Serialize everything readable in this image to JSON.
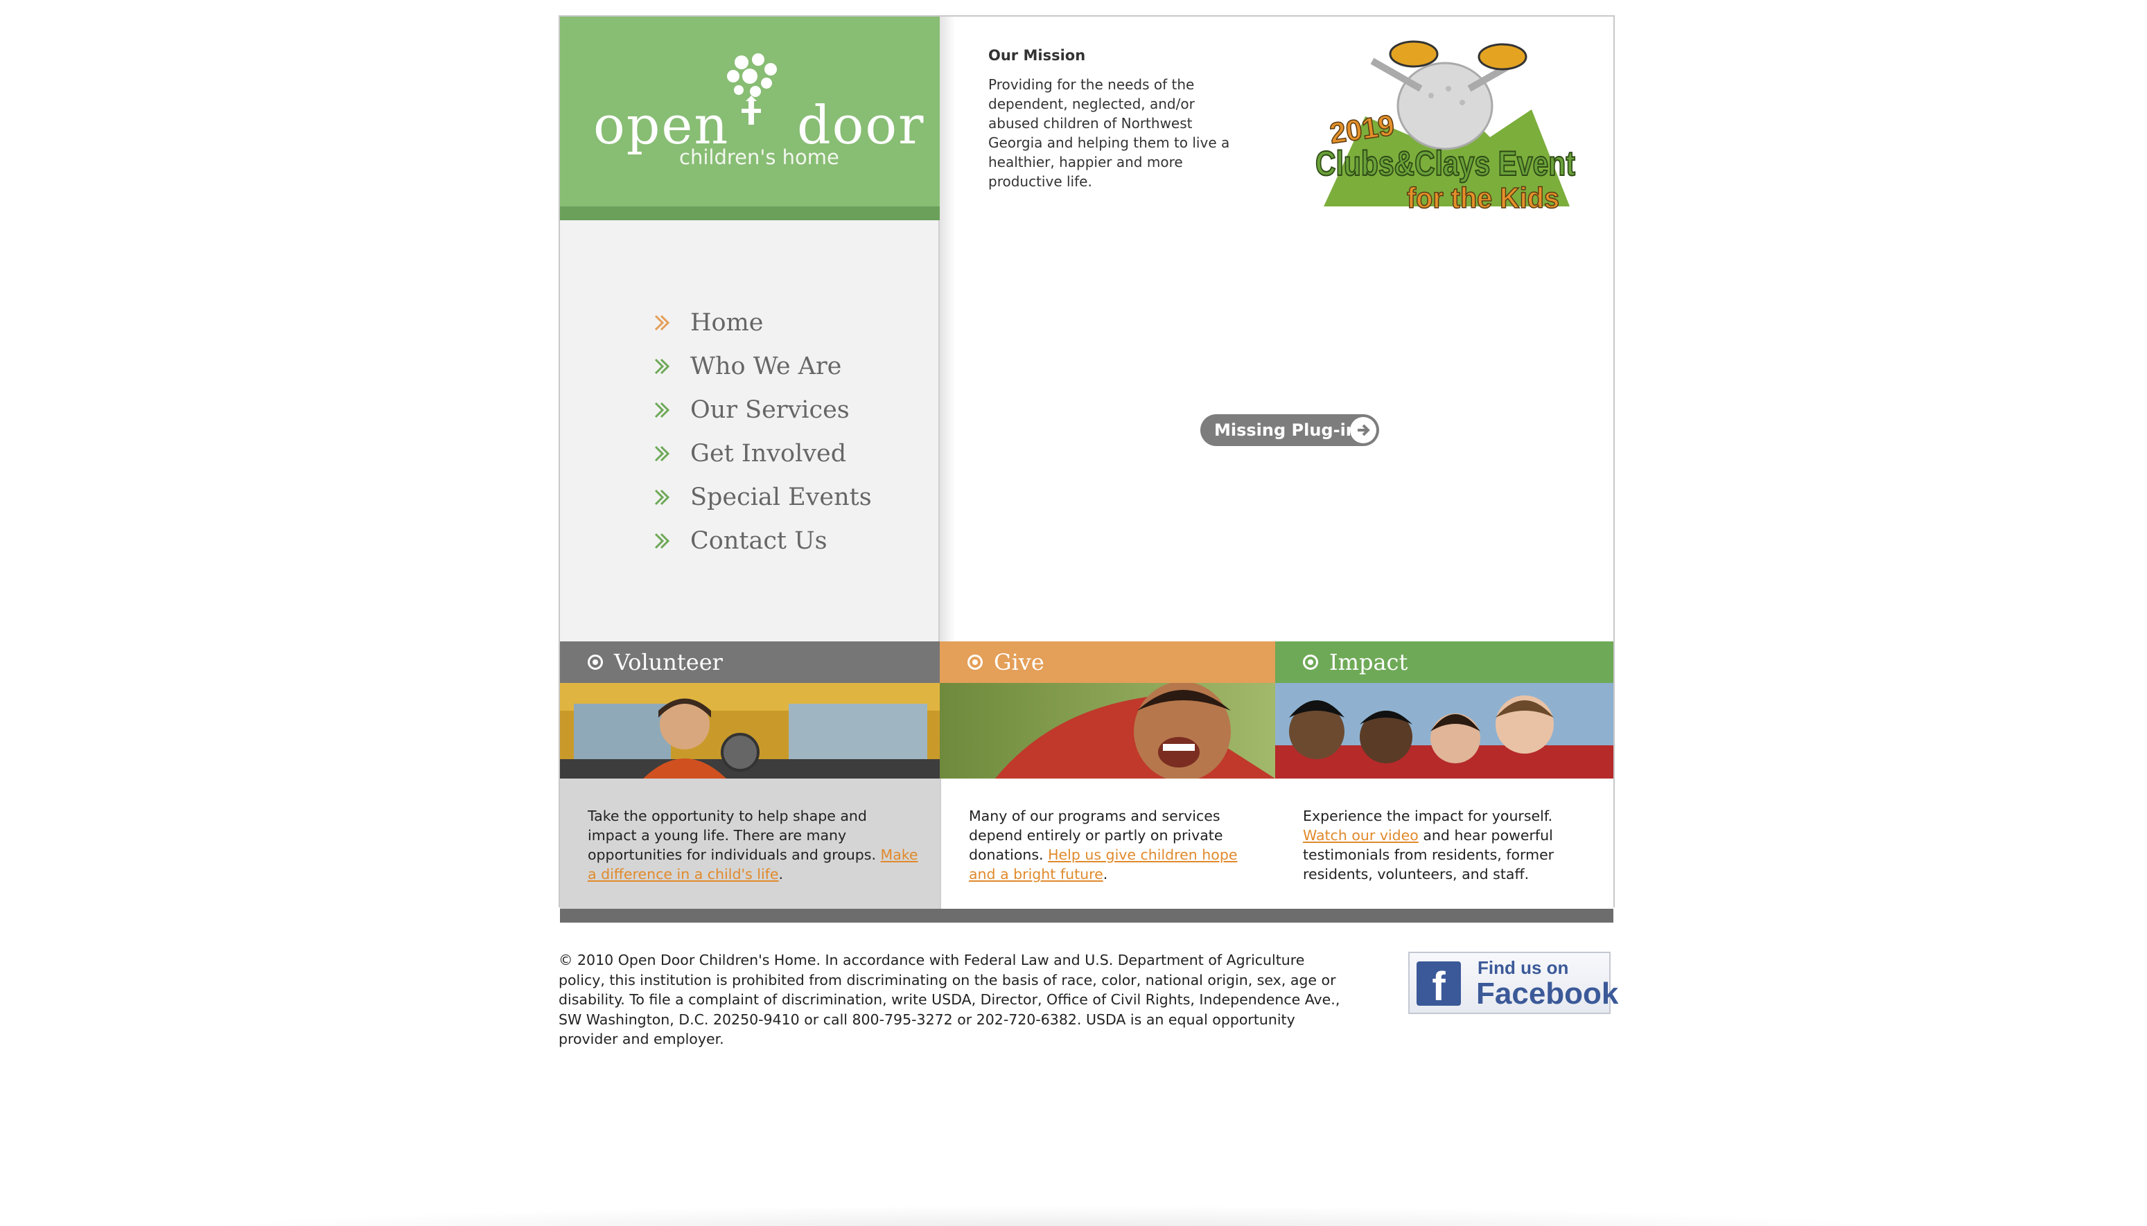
{
  "logo": {
    "word1": "open",
    "word2": "door",
    "subtitle": "children's home"
  },
  "nav": {
    "items": [
      {
        "label": "Home",
        "active": true
      },
      {
        "label": "Who We Are"
      },
      {
        "label": "Our Services"
      },
      {
        "label": "Get Involved"
      },
      {
        "label": "Special Events"
      },
      {
        "label": "Contact Us"
      }
    ]
  },
  "mission": {
    "title": "Our Mission",
    "text": "Providing for the needs of the dependent, neglected, and/or abused children of Northwest Georgia and helping them to live a healthier, happier and more productive life."
  },
  "event_badge": {
    "year": "2019",
    "line1": "Clubs&Clays Event",
    "line2": "for the Kids"
  },
  "plugin": {
    "label": "Missing Plug-in"
  },
  "bands": {
    "volunteer": "Volunteer",
    "give": "Give",
    "impact": "Impact"
  },
  "columns": {
    "volunteer": {
      "text": "Take the opportunity to help shape and impact a young life. There are many opportunities for individuals and groups.",
      "link": "Make a difference in a child's life",
      "after": "."
    },
    "give": {
      "text": "Many of our programs and services depend entirely or partly on private donations.",
      "link": "Help us give children hope and a bright future",
      "after": "."
    },
    "impact": {
      "before": "Experience the impact for yourself.",
      "link": "Watch our video",
      "text": "and hear powerful testimonials from residents, former residents, volunteers, and staff."
    }
  },
  "footer": {
    "text": "© 2010 Open Door Children's Home. In accordance with Federal Law and U.S. Department of Agriculture policy, this institution is prohibited from discriminating on the basis of race, color, national origin, sex, age or disability. To file a complaint of discrimination, write USDA, Director, Office of Civil Rights, Independence Ave., SW Washington, D.C. 20250-9410 or call 800-795-3272 or 202-720-6382. USDA is an equal opportunity provider and employer.",
    "facebook_line1": "Find us on",
    "facebook_line2": "Facebook",
    "facebook_letter": "f"
  },
  "colors": {
    "green": "#88bd74",
    "orange": "#e49f58",
    "gray": "#767676",
    "link": "#e08a2c"
  }
}
